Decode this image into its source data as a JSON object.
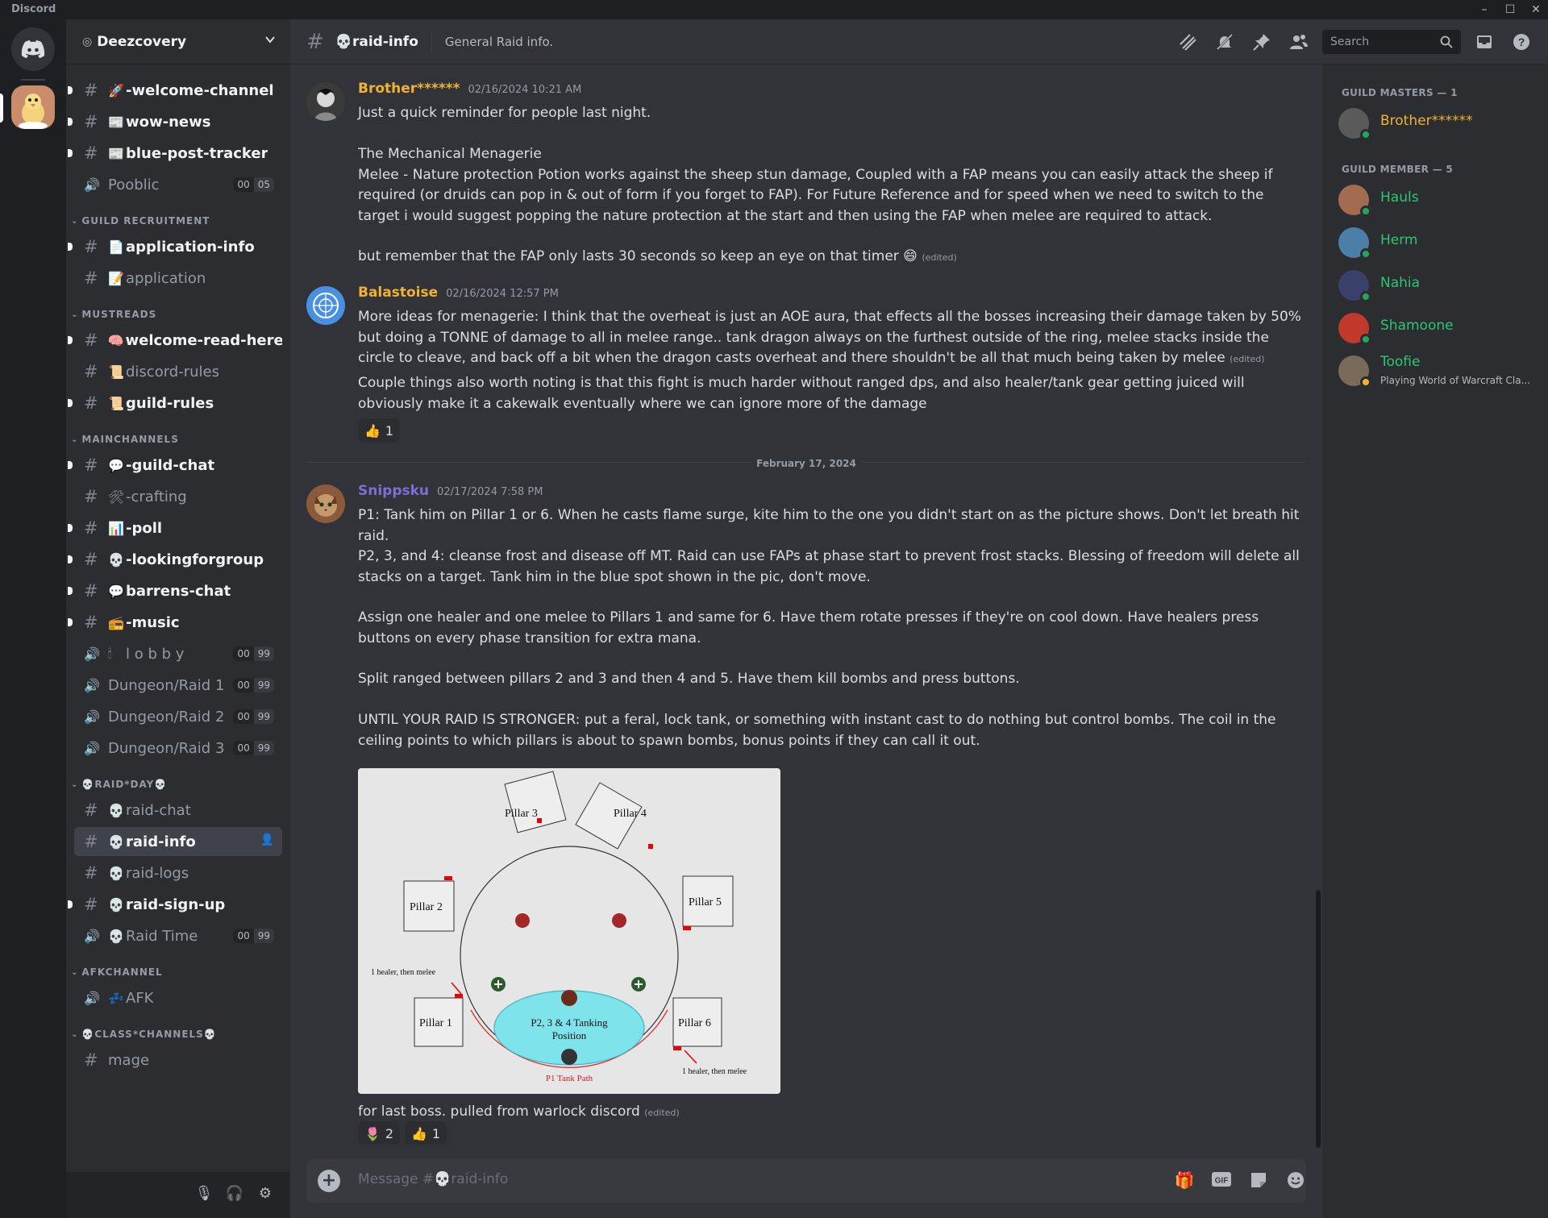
{
  "window": {
    "app_title": "Discord"
  },
  "server": {
    "name": "Deezcovery"
  },
  "sidebar": {
    "items": [
      {
        "type": "text",
        "emoji": "🚀",
        "label": "-welcome-channel",
        "unread": true
      },
      {
        "type": "text",
        "emoji": "📰",
        "label": "wow-news",
        "unread": true
      },
      {
        "type": "text",
        "emoji": "📰",
        "label": "blue-post-tracker",
        "unread": true
      },
      {
        "type": "voice",
        "emoji": "",
        "label": "Pooblic",
        "count_a": "00",
        "count_b": "05"
      },
      {
        "type": "category",
        "label": "GUILD RECRUITMENT"
      },
      {
        "type": "text",
        "emoji": "📄",
        "label": "application-info",
        "unread": true
      },
      {
        "type": "text",
        "emoji": "📝",
        "label": "application"
      },
      {
        "type": "category",
        "label": "MUSTREADS"
      },
      {
        "type": "text",
        "emoji": "🧠",
        "label": "welcome-read-here",
        "unread": true
      },
      {
        "type": "text",
        "emoji": "📜",
        "label": "discord-rules"
      },
      {
        "type": "text",
        "emoji": "📜",
        "label": "guild-rules",
        "unread": true
      },
      {
        "type": "category",
        "label": "MAINCHANNELS"
      },
      {
        "type": "text",
        "emoji": "💬",
        "label": "-guild-chat",
        "unread": true
      },
      {
        "type": "text",
        "emoji": "🛠",
        "label": "-crafting"
      },
      {
        "type": "text",
        "emoji": "📊",
        "label": "-poll",
        "unread": true
      },
      {
        "type": "text",
        "emoji": "💀",
        "label": "-lookingforgroup",
        "unread": true
      },
      {
        "type": "text",
        "emoji": "💬",
        "label": "barrens-chat",
        "unread": true
      },
      {
        "type": "text",
        "emoji": "📻",
        "label": "-music",
        "unread": true
      },
      {
        "type": "voice",
        "emoji": "🕯",
        "label": "l o b b y",
        "count_a": "00",
        "count_b": "99"
      },
      {
        "type": "voice",
        "emoji": "",
        "label": "Dungeon/Raid 1",
        "count_a": "00",
        "count_b": "99"
      },
      {
        "type": "voice",
        "emoji": "",
        "label": "Dungeon/Raid 2",
        "count_a": "00",
        "count_b": "99"
      },
      {
        "type": "voice",
        "emoji": "",
        "label": "Dungeon/Raid 3",
        "count_a": "00",
        "count_b": "99"
      },
      {
        "type": "category",
        "label": "💀RAID*DAY💀"
      },
      {
        "type": "text",
        "emoji": "💀",
        "label": "raid-chat"
      },
      {
        "type": "text",
        "emoji": "💀",
        "label": "raid-info",
        "active": true
      },
      {
        "type": "text",
        "emoji": "💀",
        "label": "raid-logs"
      },
      {
        "type": "text",
        "emoji": "💀",
        "label": "raid-sign-up",
        "unread": true
      },
      {
        "type": "voice",
        "emoji": "💀",
        "label": "Raid Time",
        "count_a": "00",
        "count_b": "99"
      },
      {
        "type": "category",
        "label": "AFKCHANNEL"
      },
      {
        "type": "voice",
        "emoji": "💤",
        "label": "AFK"
      },
      {
        "type": "category",
        "label": "💀CLASS*CHANNELS💀"
      },
      {
        "type": "text",
        "emoji": "",
        "label": "mage"
      }
    ]
  },
  "header": {
    "channel_emoji": "💀",
    "channel_name": "raid-info",
    "topic": "General Raid info.",
    "search_placeholder": "Search"
  },
  "messages": [
    {
      "author": "Brother******",
      "author_color": "#f0b232",
      "timestamp": "02/16/2024 10:21 AM",
      "paragraphs": [
        "Just a quick reminder for people last night.",
        "The Mechanical Menagerie\nMelee - Nature protection Potion works against the sheep stun damage, Coupled with a FAP means you can easily attack the sheep if required (or druids can pop in & out of form if you forget to FAP). For Future Reference and for speed when we need to switch to the target i would suggest popping the nature protection at the start and then using the FAP when melee are required to attack.",
        "but remember that the FAP only lasts 30 seconds so keep an eye on that timer 😄"
      ],
      "edited": "(edited)"
    },
    {
      "author": "Balastoise",
      "author_color": "#f0b232",
      "timestamp": "02/16/2024 12:57 PM",
      "paragraphs": [
        "More ideas for menagerie: I think that the overheat is just an AOE aura, that effects all the bosses increasing their damage taken by 50% but doing a TONNE of damage to all in melee range.. tank dragon always on the furthest outside of the ring, melee stacks inside the circle to cleave, and back off a bit when the dragon casts overheat and there shouldn't be all that much being taken by melee",
        "Couple things also worth noting is that this fight is much harder without ranged dps, and also healer/tank gear getting juiced will obviously make it a cakewalk eventually where we can ignore more of the damage"
      ],
      "edited": "(edited)",
      "reactions": [
        {
          "emoji": "👍",
          "count": "1"
        }
      ]
    },
    {
      "date_divider": "February 17, 2024",
      "author": "Snippsku",
      "author_color": "#7c6fd6",
      "timestamp": "02/17/2024 7:58 PM",
      "paragraphs": [
        "P1: Tank him on Pillar 1 or 6. When he casts flame surge, kite him to the one you didn't start on as the picture shows. Don't let breath hit raid.",
        "P2, 3, and 4: cleanse frost and disease off MT. Raid can use FAPs at phase start to prevent frost stacks. Blessing of freedom will delete all stacks on a target. Tank him in the blue spot shown in the pic, don't move.",
        "Assign one healer and one melee to Pillars 1 and same for 6. Have them rotate presses if they're on cool down. Have healers press buttons on every phase transition for extra mana.",
        "Split ranged between pillars 2 and 3 and then 4 and 5. Have them kill bombs and press buttons.",
        "UNTIL YOUR RAID IS STRONGER: put a feral, lock tank, or something with instant cast to do nothing but control bombs. The coil in the ceiling points to which pillars is about to spawn bombs, bonus points if they can call it out."
      ],
      "caption": "for last boss. pulled from warlock discord",
      "edited": "(edited)",
      "reactions": [
        {
          "emoji": "🌷",
          "count": "2"
        },
        {
          "emoji": "👍",
          "count": "1"
        }
      ],
      "diagram": {
        "pillars": [
          "Pillar 3",
          "Pillar 4",
          "Pillar 2",
          "Pillar 5",
          "Pillar 1",
          "Pillar 6"
        ],
        "tank_zone": [
          "P2, 3 & 4 Tanking",
          "Position"
        ],
        "healer_note": "1 healer, then melee",
        "path_label": "P1 Tank Path"
      }
    }
  ],
  "composer": {
    "placeholder": "Message #💀raid-info"
  },
  "members": {
    "groups": [
      {
        "title": "GUILD MASTERS — 1",
        "members": [
          {
            "name": "Brother******",
            "color": "#f0b232",
            "activity": ""
          }
        ]
      },
      {
        "title": "GUILD MEMBER — 5",
        "members": [
          {
            "name": "Hauls",
            "color": "#2dc770",
            "activity": ""
          },
          {
            "name": "Herm",
            "color": "#2dc770",
            "activity": ""
          },
          {
            "name": "Nahia",
            "color": "#2dc770",
            "activity": ""
          },
          {
            "name": "Shamoone",
            "color": "#2dc770",
            "activity": ""
          },
          {
            "name": "Toofie",
            "color": "#2dc770",
            "activity": "Playing World of Warcraft Cla..."
          }
        ]
      }
    ]
  }
}
